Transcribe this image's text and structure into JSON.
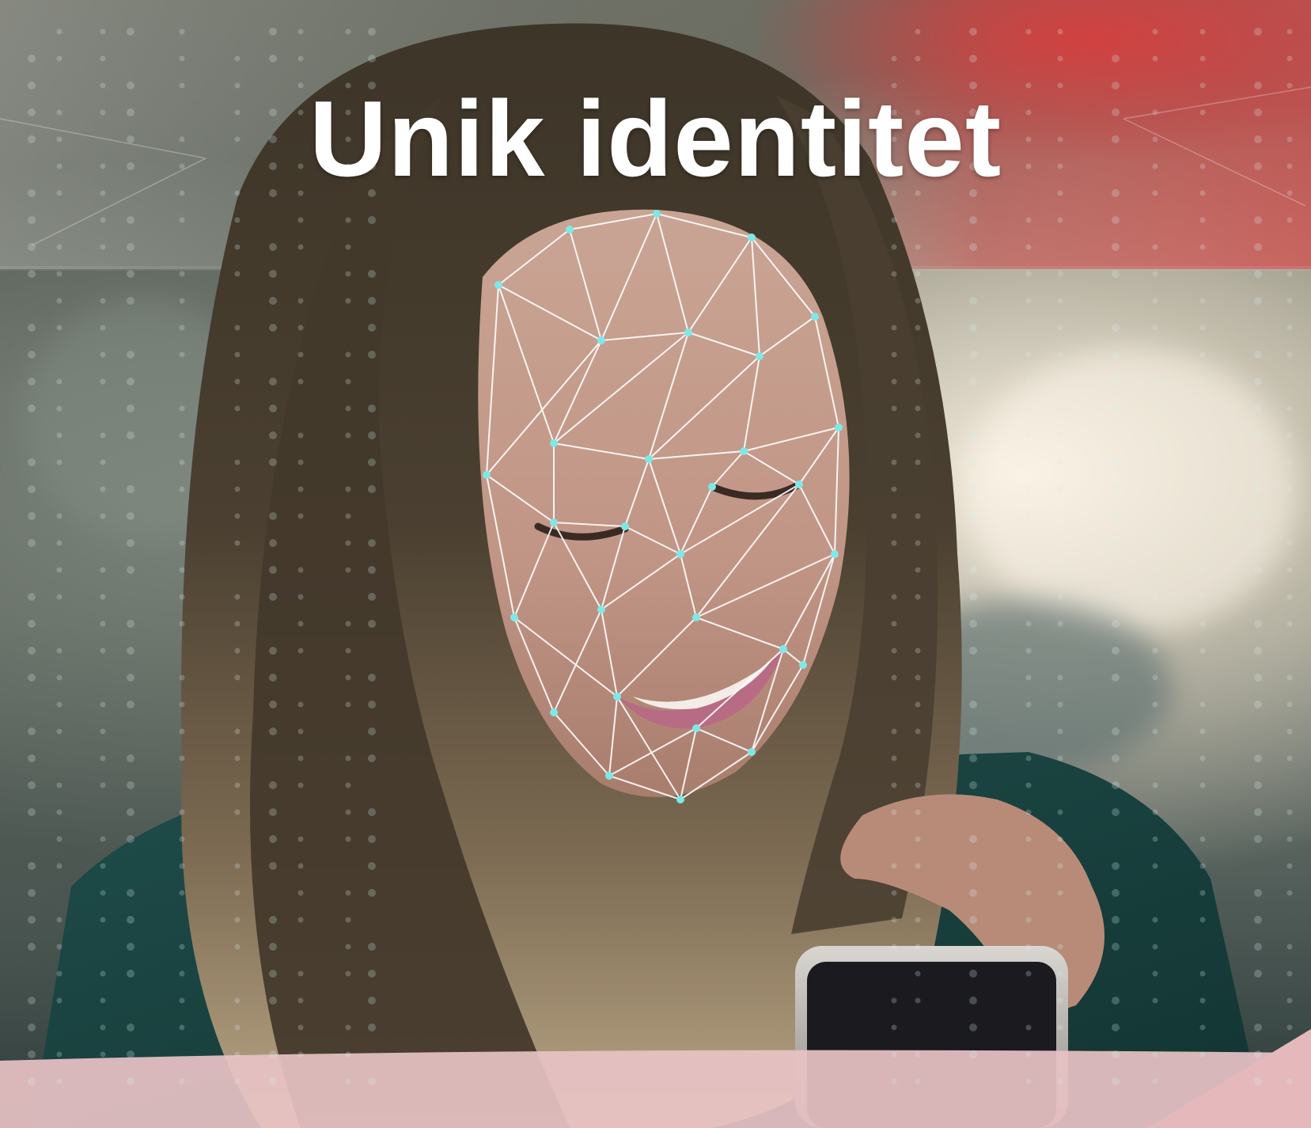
{
  "headline": "Unik identitet",
  "colors": {
    "title": "#ffffff",
    "mesh_lines": "#ffffff",
    "mesh_nodes": "#7ee8e8",
    "accent_red": "#d94b4b",
    "bottom_pink": "#e8c2c4"
  },
  "scene": {
    "subject": "woman-looking-at-phone",
    "overlay": "face-mesh"
  }
}
